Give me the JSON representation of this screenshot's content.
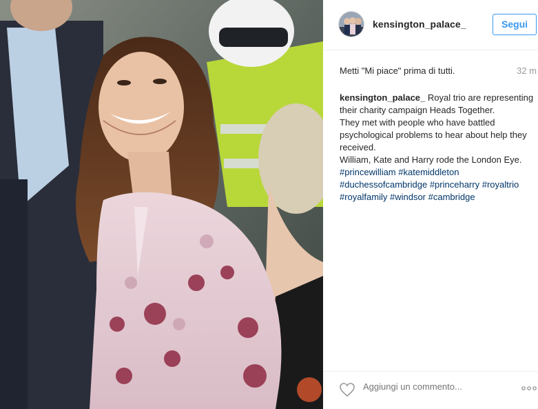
{
  "post": {
    "username": "kensington_palace_",
    "follow_label": "Segui",
    "likes_text": "Metti \"Mi piace\" prima di tutti.",
    "time_ago": "32 m",
    "caption": {
      "username": "kensington_palace_",
      "text_1": " Royal trio are representing their charity campaign Heads Together.",
      "text_2": "They met with people who have battled psychological problems to hear about help they received.",
      "text_3": "William, Kate and Harry rode the London Eye. ",
      "hashtags": [
        "#princewilliam",
        "#katemiddleton",
        "#duchessofcambridge",
        "#princeharry",
        "#royaltrio",
        "#royalfamily",
        "#windsor",
        "#cambridge"
      ]
    },
    "comment_placeholder": "Aggiungi un commento...",
    "more_label": "..."
  },
  "colors": {
    "accent": "#3897f0",
    "hashtag": "#003569",
    "muted": "#999999",
    "border": "#efefef"
  },
  "icons": {
    "like": "heart-outline-icon",
    "options": "more-dots-icon"
  }
}
